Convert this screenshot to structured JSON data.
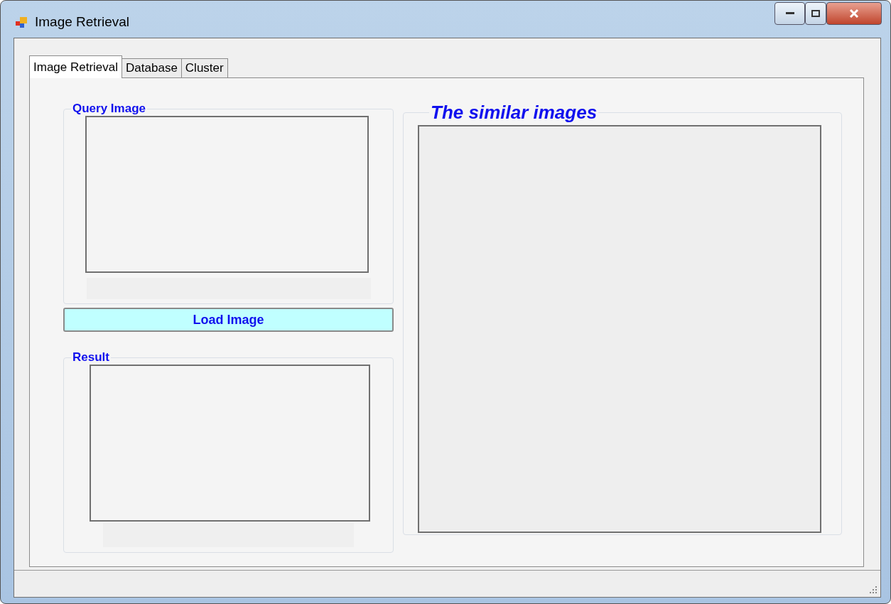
{
  "window": {
    "title": "Image Retrieval"
  },
  "tabs": [
    {
      "label": "Image Retrieval",
      "selected": true
    },
    {
      "label": "Database",
      "selected": false
    },
    {
      "label": "Cluster",
      "selected": false
    }
  ],
  "query_group": {
    "title": "Query Image"
  },
  "load_button": {
    "label": "Load Image"
  },
  "result_group": {
    "title": "Result"
  },
  "similar_group": {
    "title": "The similar images"
  }
}
